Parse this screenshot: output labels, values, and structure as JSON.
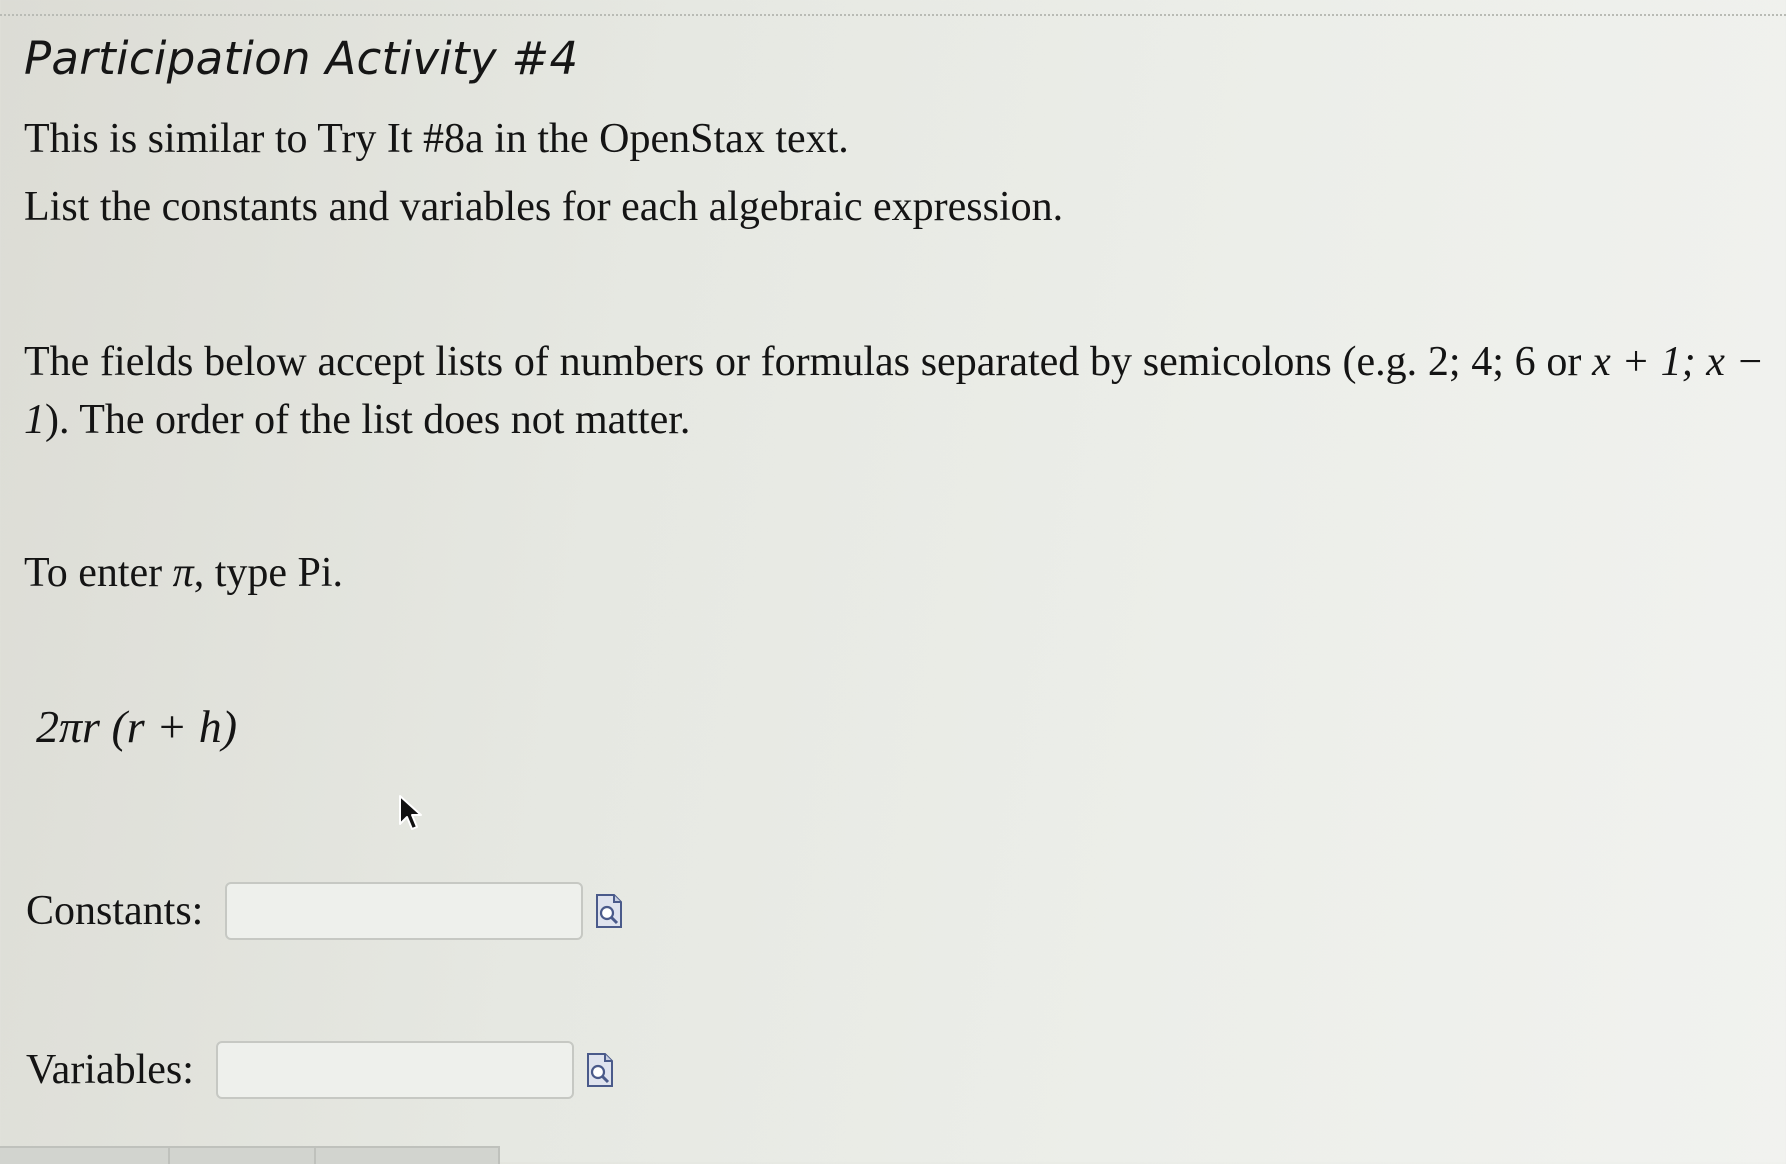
{
  "activity": {
    "title": "Participation Activity #4",
    "intro": "This is similar to Try It #8a in the OpenStax text.",
    "instruction": "List the constants and variables for each algebraic expression.",
    "help": {
      "part1": "The fields below accept lists of numbers or formulas separated by semicolons (e.g. 2; 4; 6 or ",
      "math_example": "x + 1; x − 1",
      "part2": "). The order of the list does not matter."
    },
    "pi_hint": {
      "prefix": "To enter ",
      "symbol": "π",
      "suffix": ", type Pi."
    },
    "expression": "2πr (r + h)"
  },
  "fields": {
    "constants": {
      "label": "Constants:",
      "value": "",
      "placeholder": ""
    },
    "variables": {
      "label": "Variables:",
      "value": "",
      "placeholder": ""
    }
  },
  "icons": {
    "preview": "preview-answer-icon",
    "cursor": "mouse-pointer-icon"
  },
  "colors": {
    "background": "#e6e8e2",
    "text": "#141414",
    "field_border": "#c6c8c3",
    "icon": "#4a5a8a"
  }
}
